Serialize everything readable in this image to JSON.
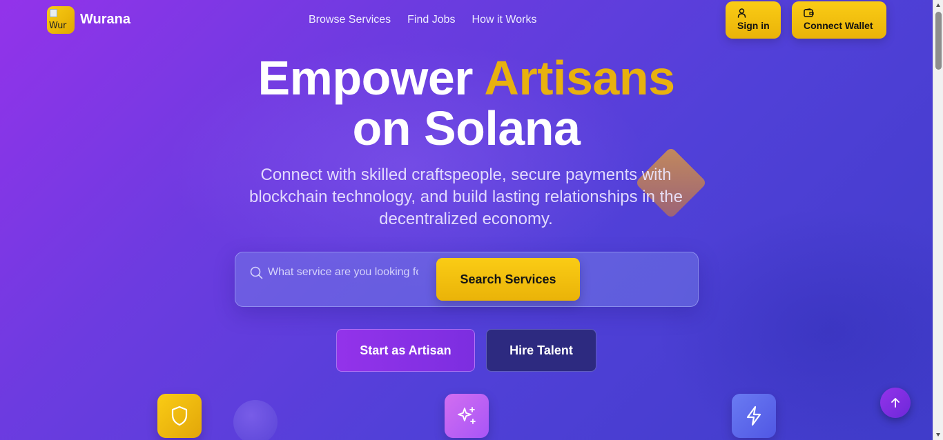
{
  "header": {
    "logo_alt": "Wur",
    "brand": "Wurana",
    "nav": [
      {
        "label": "Browse Services"
      },
      {
        "label": "Find Jobs"
      },
      {
        "label": "How it Works"
      }
    ],
    "sign_in": {
      "label": "Sign in",
      "icon": "user-icon"
    },
    "connect_wallet": {
      "label": "Connect Wallet",
      "icon": "wallet-icon"
    }
  },
  "hero": {
    "title_line1_part1": "Empower",
    "title_line1_accent": "Artisans",
    "title_line2": "on Solana",
    "subtitle": "Connect with skilled craftspeople, secure payments with blockchain technology, and build lasting relationships in the decentralized economy.",
    "accent_color": "#e8b10f"
  },
  "search": {
    "placeholder": "What service are you looking for?",
    "value": "",
    "button": "Search Services",
    "icon": "search-icon"
  },
  "cta": {
    "artisan": "Start as Artisan",
    "hire": "Hire Talent"
  },
  "features": [
    {
      "icon": "shield-icon",
      "color": "#facc15"
    },
    {
      "icon": "sparkles-icon",
      "color": "#c060f0"
    },
    {
      "icon": "lightning-icon",
      "color": "#5f6cee"
    }
  ],
  "back_to_top": {
    "icon": "arrow-up-icon"
  },
  "colors": {
    "primary_purple": "#9333ea",
    "accent_yellow": "#facc15",
    "deep_indigo": "#2d2a80"
  }
}
